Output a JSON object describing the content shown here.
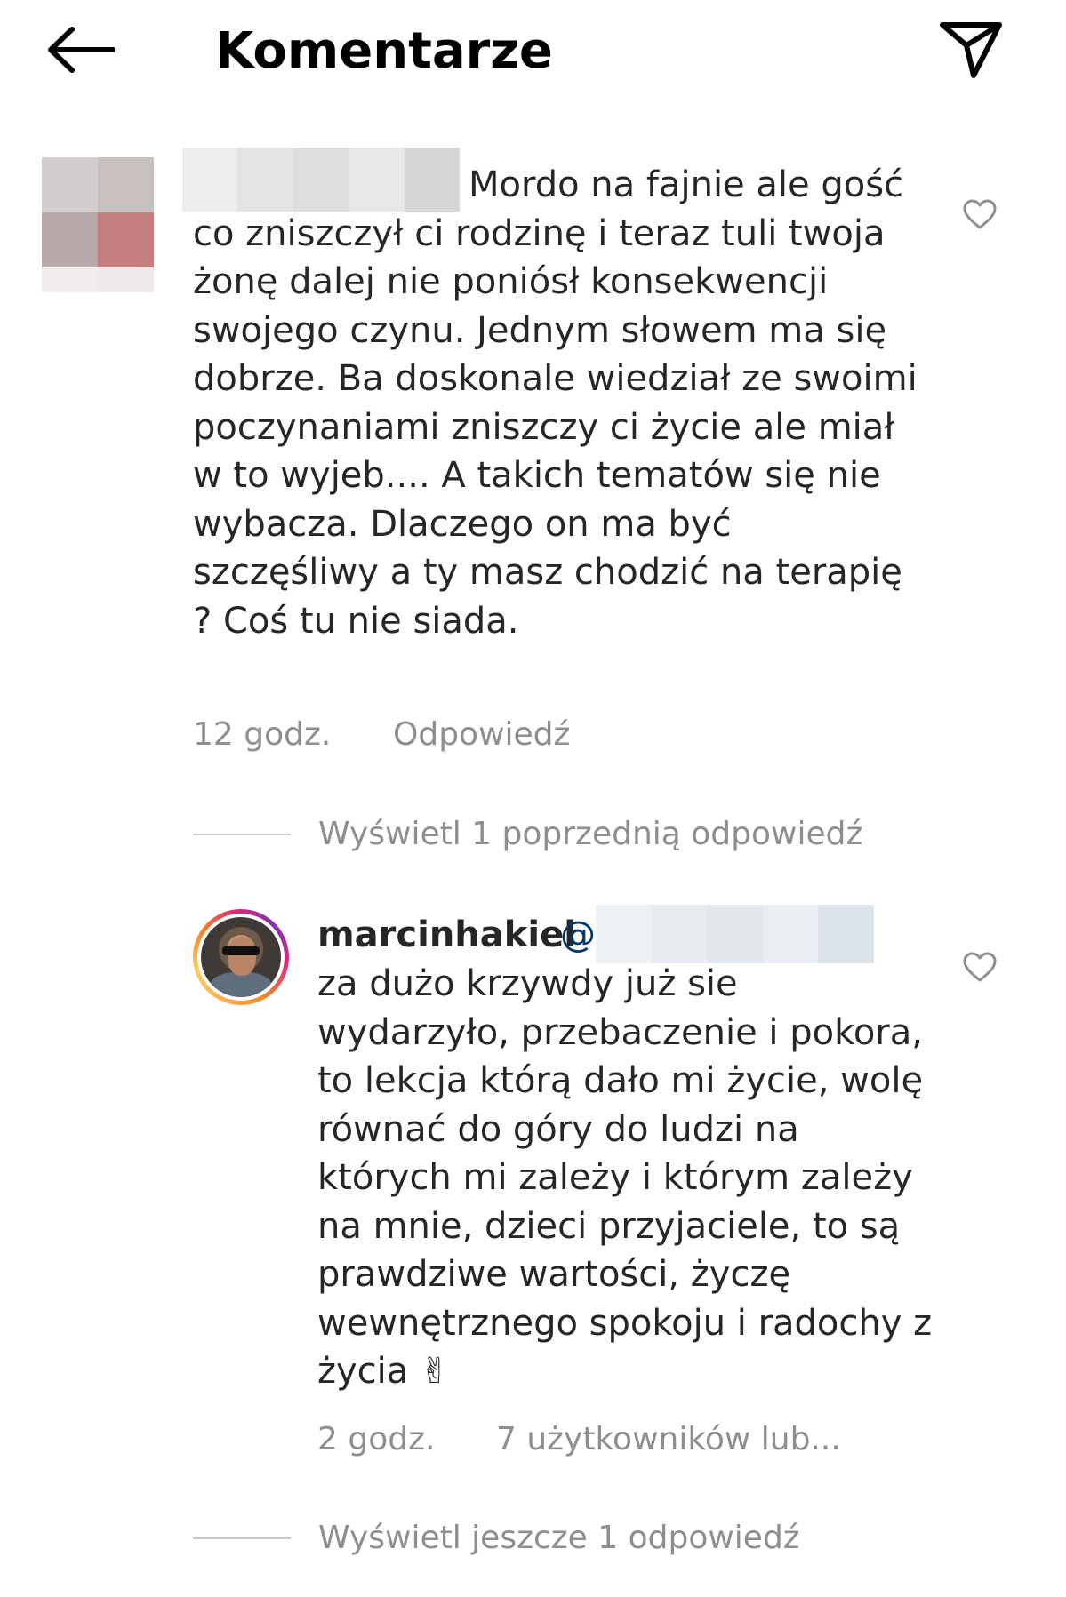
{
  "header": {
    "title": "Komentarze"
  },
  "comment1": {
    "text": "Mordo na fajnie ale gość co zniszczył ci rodzinę i teraz tuli twoja żonę dalej nie poniósł konsekwencji swojego czynu. Jednym słowem ma się dobrze. Ba doskonale wiedział ze swoimi poczynaniami zniszczy ci życie ale miał w to wyjeb.... A takich tematów się nie wybacza. Dlaczego on ma być szczęśliwy a ty masz chodzić na terapię ? Coś tu nie siada.",
    "time": "12 godz.",
    "reply_label": "Odpowiedź"
  },
  "view_previous_replies": "Wyświetl 1 poprzednią odpowiedź",
  "reply": {
    "username": "marcinhakiel",
    "mention_prefix": "@",
    "text": "za dużo krzywdy już sie wydarzyło, przebaczenie i pokora, to lekcja którą dało mi życie, wolę równać do góry do ludzi na których mi zależy i którym zależy na mnie, dzieci przyjaciele, to są prawdziwe wartości, życzę wewnętrznego spokoju i radochy z życia ✌",
    "time": "2 godz.",
    "likes": "7 użytkowników lub..."
  },
  "view_more_replies": "Wyświetl jeszcze 1 odpowiedź",
  "colors": {
    "text": "#262626",
    "muted": "#8e8e8e",
    "mention": "#00376b"
  },
  "icons": {
    "back": "arrow-left-icon",
    "share": "paper-plane-icon",
    "like": "heart-outline-icon"
  }
}
